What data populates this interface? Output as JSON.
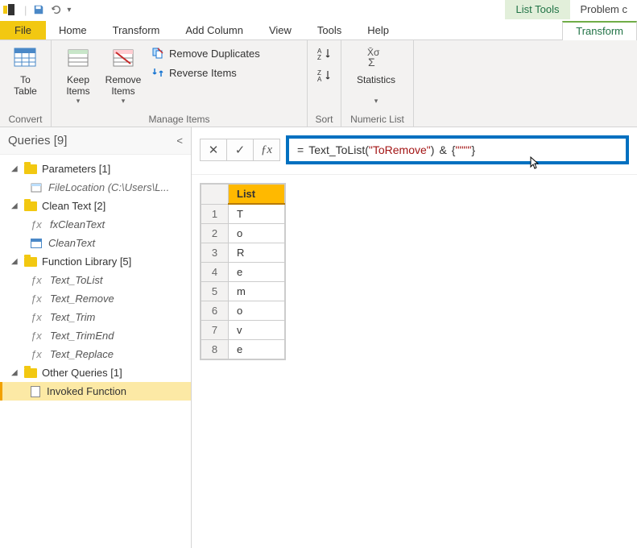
{
  "qat": {
    "save_title": "Save",
    "undo_title": "Undo"
  },
  "window": {
    "tools_tab": "List Tools",
    "title": "Problem c"
  },
  "tabs": {
    "file": "File",
    "home": "Home",
    "transform": "Transform",
    "addcolumn": "Add Column",
    "view": "View",
    "tools": "Tools",
    "help": "Help",
    "transform2": "Transform"
  },
  "ribbon": {
    "convert": {
      "to_table": "To\nTable",
      "label": "Convert"
    },
    "manage": {
      "keep": "Keep\nItems",
      "remove": "Remove\nItems",
      "remdup": "Remove Duplicates",
      "reverse": "Reverse Items",
      "label": "Manage Items"
    },
    "sort": {
      "label": "Sort"
    },
    "numeric": {
      "stats": "Statistics",
      "label": "Numeric List"
    }
  },
  "queries": {
    "header": "Queries [9]",
    "groups": [
      {
        "name": "Parameters [1]",
        "items": [
          {
            "type": "param",
            "label": "FileLocation (C:\\Users\\L..."
          }
        ]
      },
      {
        "name": "Clean Text [2]",
        "items": [
          {
            "type": "fx",
            "label": "fxCleanText"
          },
          {
            "type": "tbl",
            "label": "CleanText"
          }
        ]
      },
      {
        "name": "Function Library [5]",
        "items": [
          {
            "type": "fx",
            "label": "Text_ToList"
          },
          {
            "type": "fx",
            "label": "Text_Remove"
          },
          {
            "type": "fx",
            "label": "Text_Trim"
          },
          {
            "type": "fx",
            "label": "Text_TrimEnd"
          },
          {
            "type": "fx",
            "label": "Text_Replace"
          }
        ]
      },
      {
        "name": "Other Queries [1]",
        "items": [
          {
            "type": "sheet",
            "label": "Invoked Function",
            "selected": true
          }
        ]
      }
    ]
  },
  "formula": {
    "eq": "=",
    "fn": "Text_ToList",
    "lp": "(",
    "str": "\"ToRemove\"",
    "rp": ")",
    "amp": "&",
    "lb": "{",
    "q4": "\"\"\"\"",
    "rb": "}"
  },
  "grid": {
    "colheader": "List",
    "rows": [
      {
        "n": "1",
        "v": "T"
      },
      {
        "n": "2",
        "v": "o"
      },
      {
        "n": "3",
        "v": "R"
      },
      {
        "n": "4",
        "v": "e"
      },
      {
        "n": "5",
        "v": "m"
      },
      {
        "n": "6",
        "v": "o"
      },
      {
        "n": "7",
        "v": "v"
      },
      {
        "n": "8",
        "v": "e"
      }
    ]
  }
}
